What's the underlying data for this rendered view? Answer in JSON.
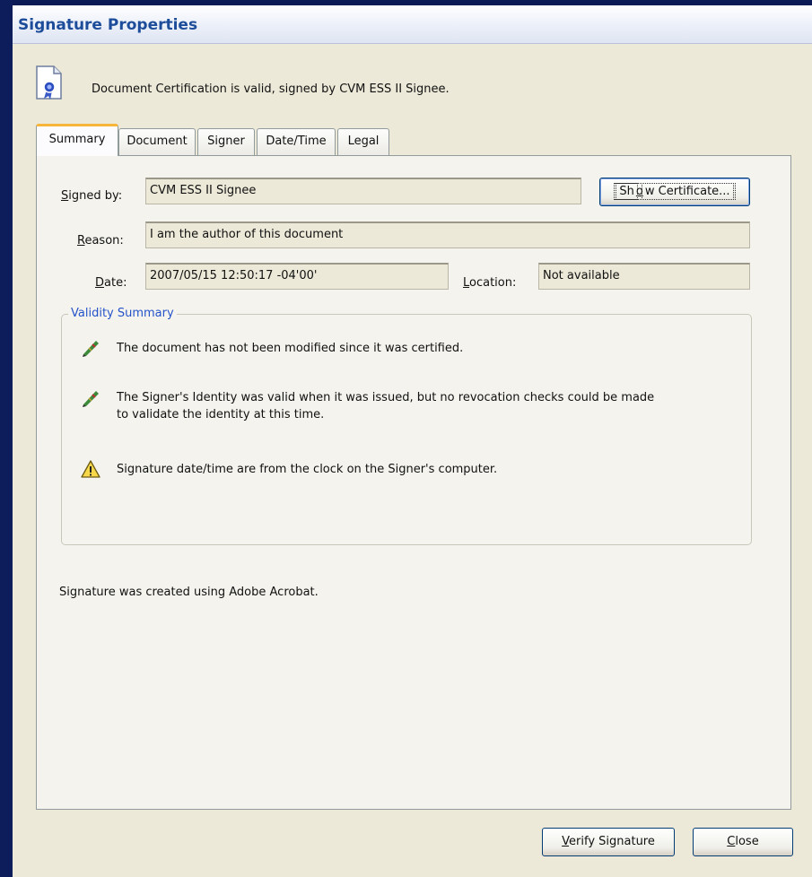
{
  "window": {
    "title": "Signature Properties"
  },
  "header": {
    "status_message": "Document Certification is valid, signed by CVM ESS II Signee.",
    "icon": "certificate-document-icon"
  },
  "tabs": [
    {
      "label": "Summary",
      "active": true
    },
    {
      "label": "Document"
    },
    {
      "label": "Signer"
    },
    {
      "label": "Date/Time"
    },
    {
      "label": "Legal"
    }
  ],
  "summary": {
    "signed_by_label_prefix": "S",
    "signed_by_label_rest": "igned by:",
    "signed_by_value": "CVM ESS II Signee",
    "show_certificate_prefix": "Sh",
    "show_certificate_key": "o",
    "show_certificate_rest": "w Certificate...",
    "reason_label_prefix": "R",
    "reason_label_rest": "eason:",
    "reason_value": "I am the author of this document",
    "date_label_prefix": "D",
    "date_label_rest": "ate:",
    "date_value": "2007/05/15 12:50:17 -04'00'",
    "location_label_prefix": "L",
    "location_label_rest": "ocation:",
    "location_value": "Not available"
  },
  "validity": {
    "title": "Validity Summary",
    "items": [
      {
        "icon": "valid-pen-icon",
        "text": "The document has not been modified since it was certified."
      },
      {
        "icon": "valid-pen-icon",
        "text": "The Signer's Identity was valid when it was issued, but no revocation checks could be made",
        "text2": "to validate the identity at this time."
      },
      {
        "icon": "warning-icon",
        "text": "Signature date/time are from the clock on the Signer's computer."
      }
    ]
  },
  "footer_note": "Signature was created using Adobe Acrobat.",
  "buttons": {
    "verify_prefix": "V",
    "verify_rest": "erify Signature",
    "close_prefix": "C",
    "close_rest": "lose"
  },
  "colors": {
    "title_text": "#1d4d9a",
    "validity_title": "#2553c9",
    "tab_active_top": "#f7b53a",
    "dialog_bg": "#ece9d8"
  }
}
